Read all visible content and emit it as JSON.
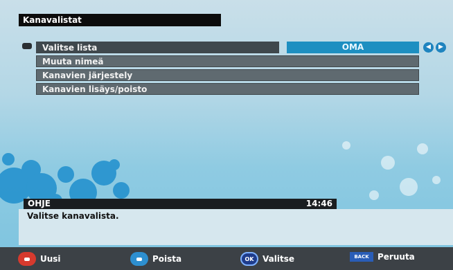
{
  "header": {
    "title": "Kanavalistat"
  },
  "menu": {
    "items": [
      {
        "label": "Valitse lista",
        "value": "OMA"
      },
      {
        "label": "Muuta nimeä"
      },
      {
        "label": "Kanavien järjestely"
      },
      {
        "label": "Kanavien lisäys/poisto"
      }
    ]
  },
  "help": {
    "title": "OHJE",
    "time": "14:46",
    "text": "Valitse kanavalista."
  },
  "footer": {
    "red_label": "Uusi",
    "blue_label": "Poista",
    "ok_icon": "OK",
    "ok_label": "Valitse",
    "back_icon": "BACK",
    "back_label": "Peruuta"
  },
  "colors": {
    "accent": "#1d8fc1",
    "background": "#b3d7e6",
    "menu_item": "#5f6a70"
  },
  "icons": [
    "selection-bullet-icon",
    "left-arrow-icon",
    "right-arrow-icon",
    "red-button-icon",
    "blue-button-icon",
    "ok-button-icon",
    "back-button-icon"
  ]
}
